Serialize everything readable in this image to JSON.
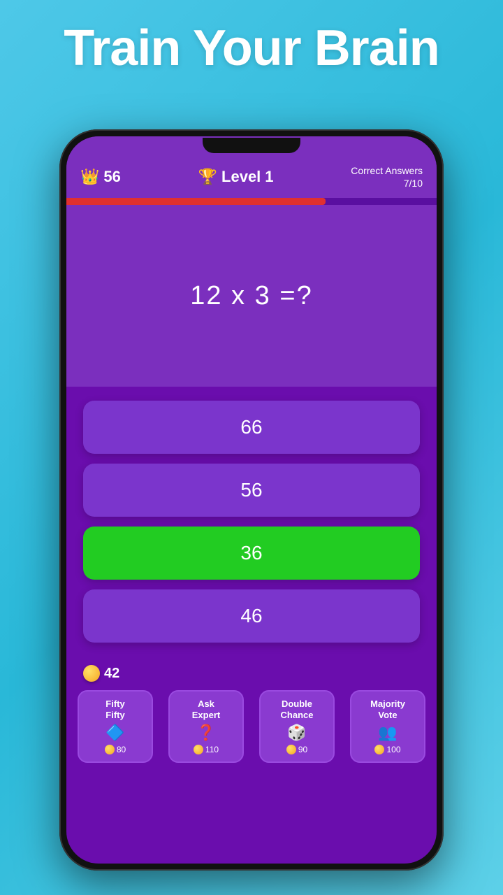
{
  "headline": "Train Your Brain",
  "header": {
    "score": "56",
    "level_label": "Level",
    "level_number": "1",
    "correct_answers_label": "Correct Answers",
    "correct_answers_value": "7/10"
  },
  "progress": {
    "percent": 70
  },
  "question": {
    "text": "12 x 3 =?"
  },
  "answers": [
    {
      "value": "66",
      "correct": false
    },
    {
      "value": "56",
      "correct": false
    },
    {
      "value": "36",
      "correct": true
    },
    {
      "value": "46",
      "correct": false
    }
  ],
  "coins": {
    "icon": "coin",
    "amount": "42"
  },
  "powerups": [
    {
      "label": "Fifty\nFifty",
      "icon": "🔷",
      "icon_label": "fifty-fifty-icon",
      "cost": "80"
    },
    {
      "label": "Ask\nExpert",
      "icon": "❓",
      "icon_label": "ask-expert-icon",
      "cost": "110"
    },
    {
      "label": "Double\nChance",
      "icon": "🎲",
      "icon_label": "double-chance-icon",
      "cost": "90"
    },
    {
      "label": "Majority\nVote",
      "icon": "👥",
      "icon_label": "majority-vote-icon",
      "cost": "100"
    }
  ]
}
